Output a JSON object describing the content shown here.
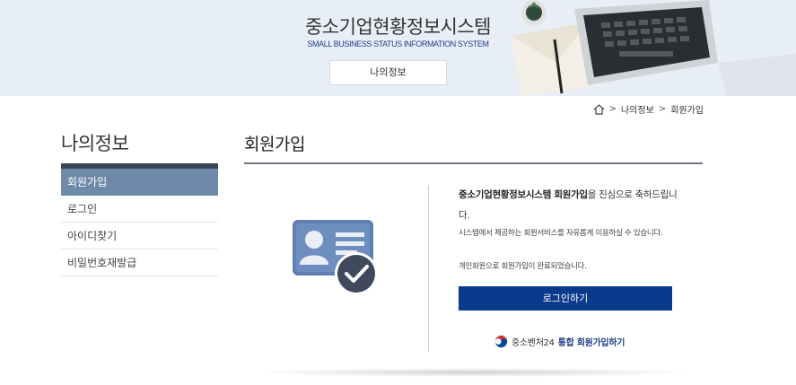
{
  "header": {
    "title": "중소기업현황정보시스템",
    "subtitle": "SMALL BUSINESS STATUS INFORMATION SYSTEM",
    "section_button": "나의정보"
  },
  "breadcrumb": {
    "items": [
      "나의정보",
      "회원가입"
    ],
    "separator": ">"
  },
  "sidebar": {
    "title": "나의정보",
    "items": [
      {
        "label": "회원가입",
        "active": true
      },
      {
        "label": "로그인",
        "active": false
      },
      {
        "label": "아이디찾기",
        "active": false
      },
      {
        "label": "비밀번호재발급",
        "active": false
      }
    ]
  },
  "main": {
    "title": "회원가입",
    "message_bold": "중소기업현황정보시스템 회원가입",
    "message_rest": "을 진심으로 축하드립니다.",
    "service_note": "시스템에서 제공하는 회원서비스를 자유롭게 이용하실 수 있습니다.",
    "complete_note": "개인회원으로 회원가입이 완료되었습니다.",
    "login_button": "로그인하기",
    "gov_name": "중소벤처24",
    "gov_action": "통합 회원가입하기"
  },
  "colors": {
    "accent": "#0a3a8c",
    "sidebar_active": "#6f8aa8",
    "banner_bg": "#e8eef6"
  }
}
